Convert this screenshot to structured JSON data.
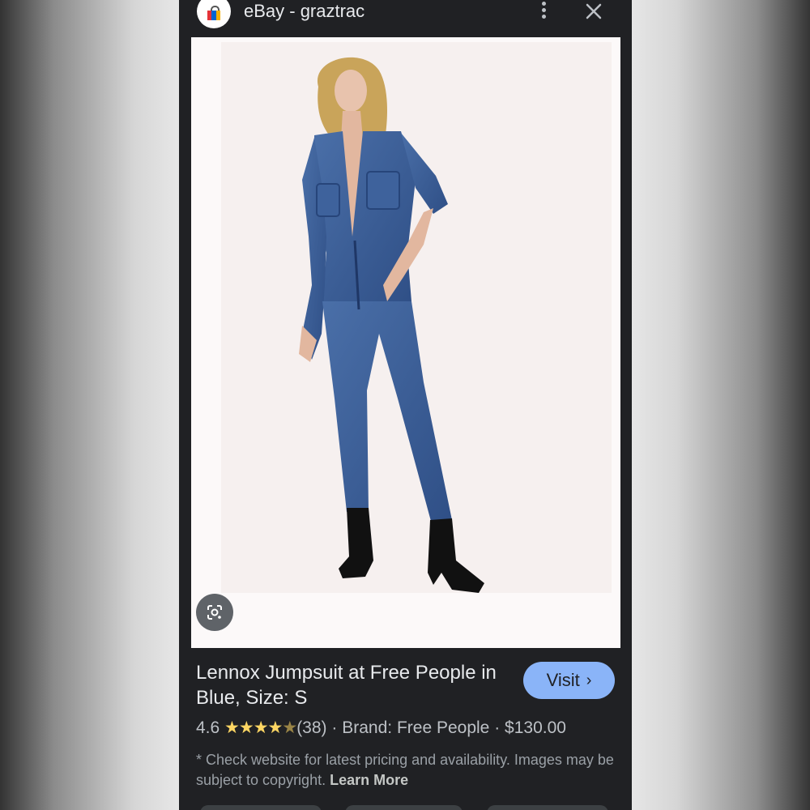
{
  "header": {
    "site_title": "eBay - graztrac",
    "favicon_icon": "ebay-shopping-bag-icon",
    "more_icon": "more-vert-icon",
    "close_icon": "close-icon"
  },
  "image": {
    "lens_icon": "google-lens-icon"
  },
  "product": {
    "title": "Lennox Jumpsuit at Free People in Blue, Size: S",
    "rating": "4.6",
    "stars": "★★★★",
    "half_star": "★",
    "review_count": "(38)",
    "separator": "·",
    "brand": "Brand: Free People",
    "price": "$130.00",
    "visit_label": "Visit",
    "visit_chevron": "›"
  },
  "disclaimer": {
    "text": "* Check website for latest pricing and availability. Images may be subject to copyright.",
    "learn_more": "Learn More"
  },
  "colors": {
    "background": "#202124",
    "accent": "#8ab4f8",
    "star": "#fdd663"
  }
}
